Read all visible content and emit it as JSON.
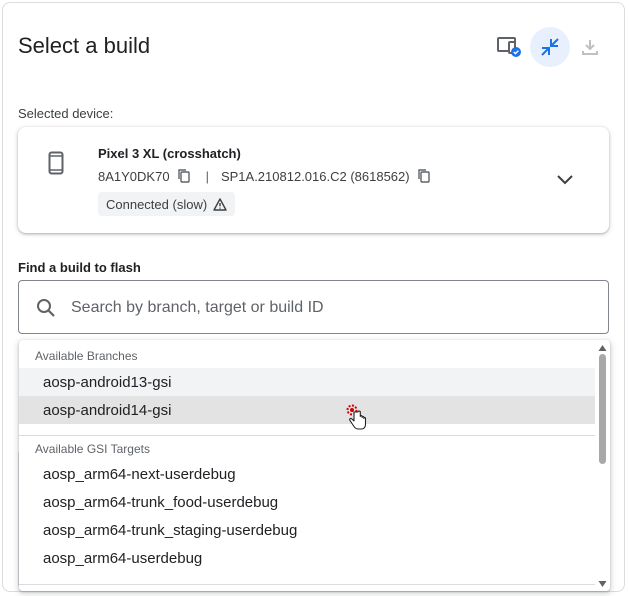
{
  "header": {
    "title": "Select a build",
    "buttons": [
      {
        "name": "device-mode-icon"
      },
      {
        "name": "collapse-arrows-icon"
      },
      {
        "name": "download-icon"
      }
    ]
  },
  "device": {
    "section_label": "Selected device:",
    "name": "Pixel 3 XL (crosshatch)",
    "serial": "8A1Y0DK70",
    "separator": "|",
    "build": "SP1A.210812.016.C2 (8618562)",
    "status": "Connected (slow)"
  },
  "search": {
    "label": "Find a build to flash",
    "value": "",
    "placeholder": "Search by branch, target or build ID"
  },
  "dropdown": {
    "branches_title": "Available Branches",
    "branches": [
      "aosp-android13-gsi",
      "aosp-android14-gsi"
    ],
    "targets_title": "Available GSI Targets",
    "targets": [
      "aosp_arm64-next-userdebug",
      "aosp_arm64-trunk_food-userdebug",
      "aosp_arm64-trunk_staging-userdebug",
      "aosp_arm64-userdebug"
    ]
  },
  "colors": {
    "accent": "#1a73e8",
    "warning": "#3c4043"
  }
}
